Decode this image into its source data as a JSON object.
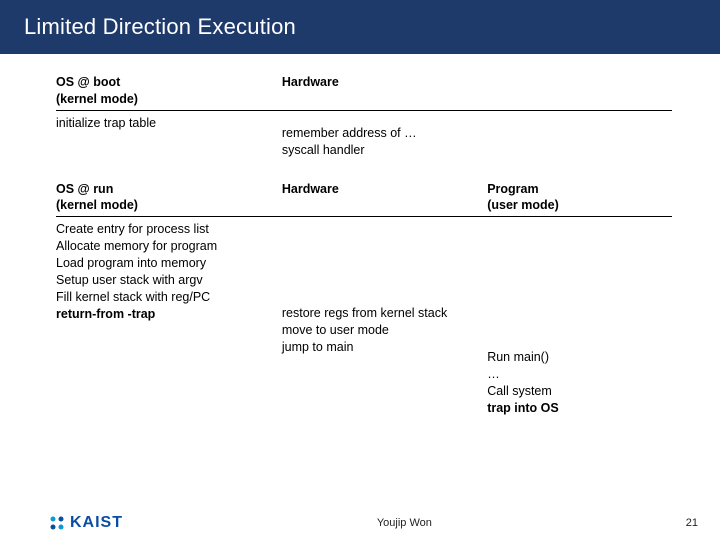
{
  "title": "Limited Direction Execution",
  "sec1": {
    "h1a": "OS @ boot",
    "h1b": "(kernel mode)",
    "h2": "Hardware",
    "r1c1": "initialize trap table",
    "r1c2a": "remember address of …",
    "r1c2b": "syscall handler"
  },
  "sec2": {
    "h1a": "OS @ run",
    "h1b": "(kernel mode)",
    "h2": "Hardware",
    "h3a": "Program",
    "h3b": "(user mode)",
    "c1l1": "Create entry for process list",
    "c1l2": "Allocate memory for program",
    "c1l3": "Load program into memory",
    "c1l4": "Setup user stack with argv",
    "c1l5": "Fill kernel stack with reg/PC",
    "c1l6": "return-from -trap",
    "c2l1": "restore regs from kernel stack",
    "c2l2": "move to user mode",
    "c2l3": "jump to main",
    "c3l1": "Run main()",
    "c3l2": "…",
    "c3l3": "Call system",
    "c3l4": "trap into OS"
  },
  "footer": {
    "logo": "KAIST",
    "author": "Youjip Won",
    "page": "21"
  }
}
